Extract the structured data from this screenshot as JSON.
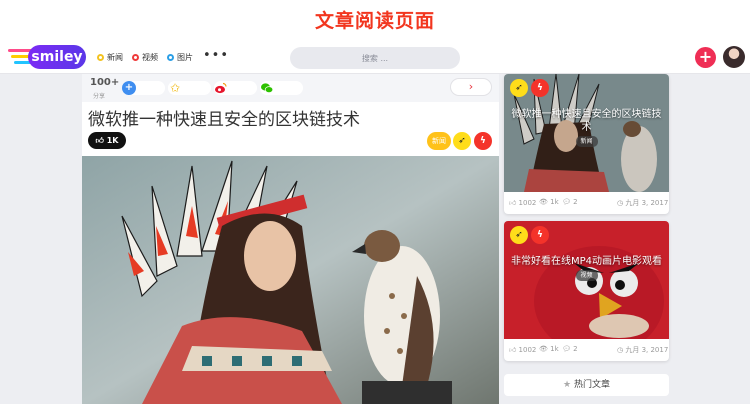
{
  "page": {
    "heading": "文章阅读页面"
  },
  "nav": {
    "logo_text": "smiley",
    "items": [
      {
        "label": "新闻",
        "color": "#f3c321"
      },
      {
        "label": "视频",
        "color": "#ef3b3b"
      },
      {
        "label": "图片",
        "color": "#2b9fe6"
      }
    ],
    "more_label": "•••",
    "search_placeholder": "搜索 ...",
    "add_label": "+"
  },
  "share": {
    "count": "100+",
    "count_label": "分享",
    "next_label": "›"
  },
  "article": {
    "title": "微软推一种快速且安全的区块链技术",
    "likes": "1K",
    "like_icon": "thumbs-up-icon",
    "category": "新闻"
  },
  "sidebar": {
    "cards": [
      {
        "title": "微软推一种快速且安全的区块链技术",
        "tag": "新闻",
        "likes": "1002",
        "views": "1k",
        "comments": "2",
        "date": "九月 3, 2017"
      },
      {
        "title": "非常好看在线MP4动画片电影观看",
        "tag": "视频",
        "likes": "1002",
        "views": "1k",
        "comments": "2",
        "date": "九月 3, 2017"
      }
    ],
    "hot_label": "热门文章"
  },
  "colors": {
    "accent_red": "#f2361f",
    "like_pink": "#ef2e55",
    "badge_yellow": "#ffdd1a",
    "badge_red": "#f4332a"
  }
}
